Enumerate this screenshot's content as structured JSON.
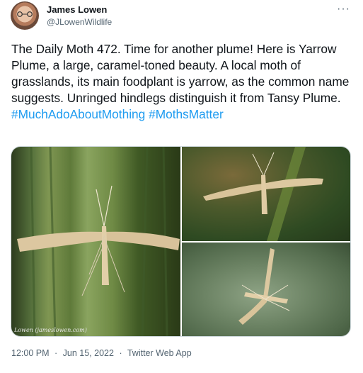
{
  "author": {
    "name": "James Lowen",
    "handle": "@JLowenWildlife"
  },
  "tweet": {
    "text": "The Daily Moth 472. Time for another plume! Here is Yarrow Plume, a large, caramel-toned beauty. A local moth of grasslands, its main foodplant is yarrow, as the common name suggests. Unringed hindlegs distinguish it from Tansy Plume.",
    "hashtags": [
      "#MuchAdoAboutMothing",
      "#MothsMatter"
    ]
  },
  "media": {
    "credit": "Lowen (jameslowen.com)"
  },
  "meta": {
    "time": "12:00 PM",
    "date": "Jun 15, 2022",
    "separator": "·",
    "source": "Twitter Web App"
  },
  "icons": {
    "more": "more-options-icon"
  }
}
